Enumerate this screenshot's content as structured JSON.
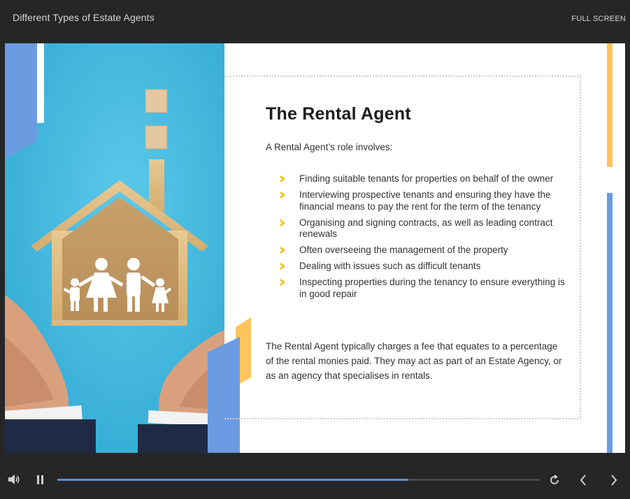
{
  "header": {
    "course_title": "Different Types of Estate Agents",
    "fullscreen_label": "FULL SCREEN"
  },
  "slide": {
    "heading": "The Rental Agent",
    "intro": "A Rental Agent’s role involves:",
    "bullets": [
      "Finding suitable tenants for properties on behalf of the owner",
      "Interviewing prospective tenants and ensuring they have the financial means to pay the rent for the term of the tenancy",
      "Organising and signing contracts, as well as leading contract renewals",
      "Often overseeing the management of the property",
      "Dealing with issues such as difficult tenants",
      "Inspecting properties during the tenancy to ensure everything is in good repair"
    ],
    "summary": "The Rental Agent typically charges a fee that equates to a percentage of the rental monies paid. They may act as part of an Estate Agency, or as an agency that specialises in rentals."
  },
  "player": {
    "progress_fraction": 0.727,
    "icons": [
      "volume-icon",
      "pause-icon",
      "replay-icon",
      "previous-icon",
      "next-icon"
    ]
  },
  "colors": {
    "background": "#262626",
    "accent_blue": "#5d8fd6",
    "accent_yellow": "#fdc45c",
    "bullet_chevron": "#f5b800",
    "photo_sky": "#3db5dc"
  }
}
